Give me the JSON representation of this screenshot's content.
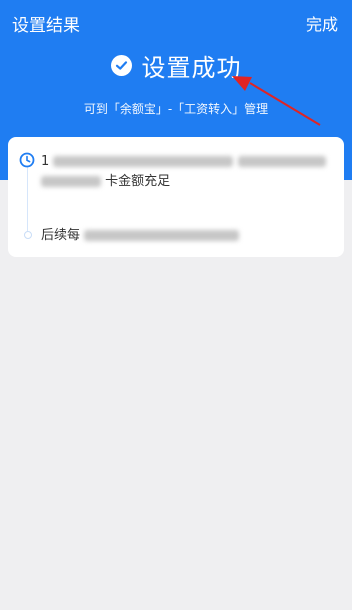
{
  "nav": {
    "title": "设置结果",
    "done_label": "完成"
  },
  "result": {
    "status_text": "设置成功",
    "hint": "可到「余额宝」-「工资转入」管理"
  },
  "card": {
    "line1_prefix": "1",
    "line2_suffix": "卡金额充足",
    "line3_prefix": "后续每"
  },
  "colors": {
    "brand": "#1f7df2",
    "annotation_arrow": "#e02424"
  }
}
